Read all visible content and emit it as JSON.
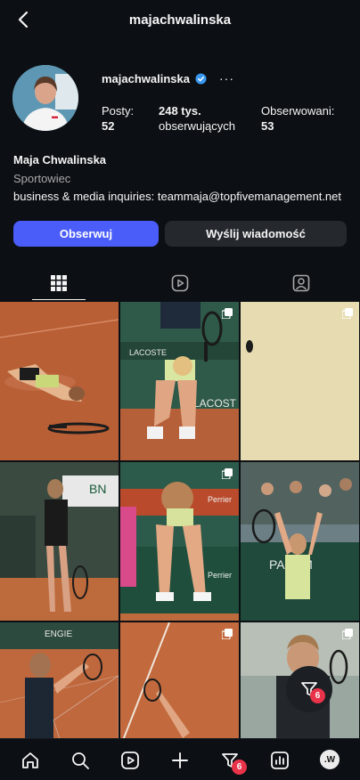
{
  "header": {
    "title": "majachwalinska"
  },
  "profile": {
    "username": "majachwalinska",
    "stats": {
      "posts_label": "Posty:",
      "posts_value": "52",
      "followers_value": "248 tys.",
      "followers_label": "obserwujących",
      "following_label": "Obserwowani:",
      "following_value": "53"
    },
    "full_name": "Maja Chwalinska",
    "category": "Sportowiec",
    "bio": "business & media inquiries: teammaja@topfivemanagement.net"
  },
  "actions": {
    "follow": "Obserwuj",
    "message": "Wyślij wiadomość"
  },
  "tabs": [
    {
      "name": "posts-grid",
      "icon": "grid-icon"
    },
    {
      "name": "reels",
      "icon": "reels-icon"
    },
    {
      "name": "tagged",
      "icon": "tagged-icon"
    }
  ],
  "floating_button": {
    "icon": "filter-icon",
    "badge": "6"
  },
  "bottom_nav": {
    "items": [
      "home-icon",
      "search-icon",
      "reels-icon",
      "plus-icon",
      "filter-icon",
      "stats-icon",
      "profile-avatar"
    ],
    "filter_badge": "6",
    "avatar_text": ".W"
  },
  "colors": {
    "background": "#0c1014",
    "accent": "#4a5df9",
    "badge": "#e8334a",
    "secondary_button": "#25292e"
  }
}
